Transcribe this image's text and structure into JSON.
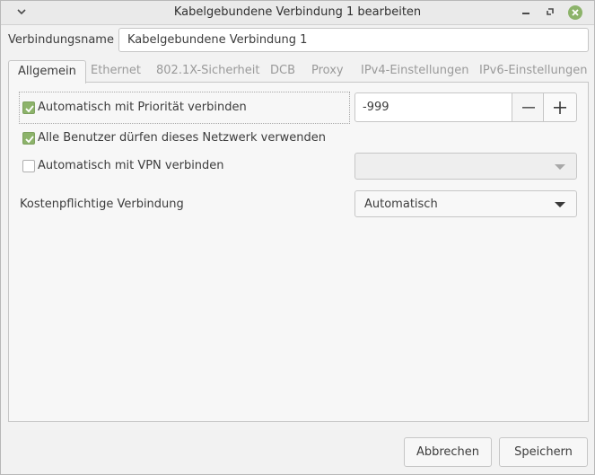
{
  "window": {
    "title": "Kabelgebundene Verbindung 1 bearbeiten",
    "accent": "#8cb36a"
  },
  "connection": {
    "name_label": "Verbindungsname",
    "name_value": "Kabelgebundene Verbindung 1"
  },
  "tabs": [
    {
      "label": "Allgemein",
      "active": true
    },
    {
      "label": "Ethernet"
    },
    {
      "label": "802.1X-Sicherheit"
    },
    {
      "label": "DCB"
    },
    {
      "label": "Proxy"
    },
    {
      "label": "IPv4-Einstellungen"
    },
    {
      "label": "IPv6-Einstellungen"
    }
  ],
  "general": {
    "auto_connect": {
      "label": "Automatisch mit Priorität verbinden",
      "checked": true
    },
    "priority_value": "-999",
    "all_users": {
      "label": "Alle Benutzer dürfen dieses Netzwerk verwenden",
      "checked": true
    },
    "auto_vpn": {
      "label": "Automatisch mit VPN verbinden",
      "checked": false
    },
    "vpn_selected": "",
    "metered_label": "Kostenpflichtige Verbindung",
    "metered_value": "Automatisch"
  },
  "buttons": {
    "cancel": "Abbrechen",
    "save": "Speichern"
  },
  "icons": [
    "window-menu-icon",
    "minimize-icon",
    "restore-icon",
    "close-icon",
    "check-icon",
    "minus-icon",
    "plus-icon",
    "dropdown-arrow-icon"
  ]
}
